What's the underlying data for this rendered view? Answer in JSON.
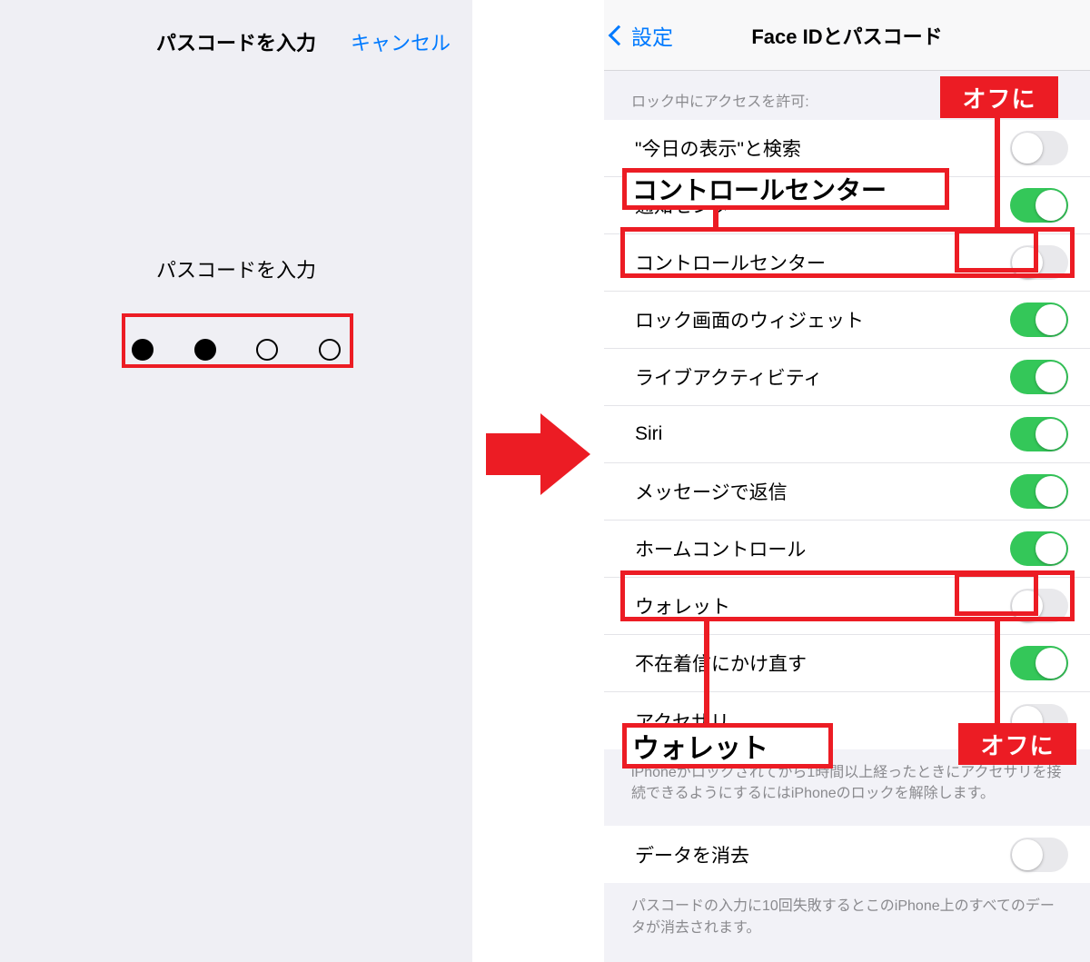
{
  "left": {
    "nav_title": "パスコードを入力",
    "nav_cancel": "キャンセル",
    "prompt": "パスコードを入力",
    "dots_filled": [
      true,
      true,
      false,
      false
    ]
  },
  "right": {
    "back_label": "設定",
    "nav_title": "Face IDとパスコード",
    "section_header": "ロック中にアクセスを許可:",
    "rows": [
      {
        "label": "\"今日の表示\"と検索",
        "on": false
      },
      {
        "label": "通知センター",
        "on": true
      },
      {
        "label": "コントロールセンター",
        "on": false
      },
      {
        "label": "ロック画面のウィジェット",
        "on": true
      },
      {
        "label": "ライブアクティビティ",
        "on": true
      },
      {
        "label": "Siri",
        "on": true
      },
      {
        "label": "メッセージで返信",
        "on": true
      },
      {
        "label": "ホームコントロール",
        "on": true
      },
      {
        "label": "ウォレット",
        "on": false
      },
      {
        "label": "不在着信にかけ直す",
        "on": true
      },
      {
        "label": "アクセサリ",
        "on": false
      }
    ],
    "accessory_footer": "iPhoneがロックされてから1時間以上経ったときにアクセサリを接続できるようにするにはiPhoneのロックを解除します。",
    "erase_label": "データを消去",
    "erase_on": false,
    "erase_footer": "パスコードの入力に10回失敗するとこのiPhone上のすべてのデータが消去されます。"
  },
  "annotations": {
    "off_badge": "オフに",
    "big_cc": "コントロールセンター",
    "big_wallet": "ウォレット"
  }
}
